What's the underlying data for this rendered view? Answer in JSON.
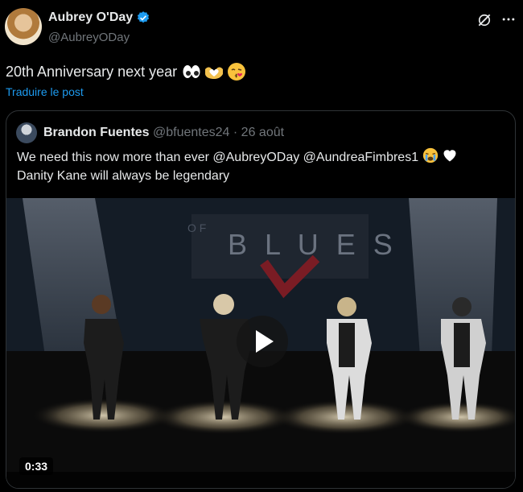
{
  "author": {
    "name": "Aubrey O'Day",
    "handle": "@AubreyODay",
    "verified": true
  },
  "post": {
    "text": "20th Anniversary next year",
    "emojis": [
      "eyes-icon",
      "hand-heart-icon",
      "kissing-face-icon"
    ]
  },
  "translate_label": "Traduire le post",
  "quote": {
    "name": "Brandon Fuentes",
    "handle": "@bfuentes24",
    "separator": "·",
    "date": "26 août",
    "text_line1": "We need this now more than ever @AubreyODay @AundreaFimbres1",
    "text_line2": "Danity Kane will always be legendary",
    "line1_emojis": [
      "crying-face-icon",
      "white-heart-icon"
    ],
    "video": {
      "duration": "0:33",
      "sign_letters": "OF BLUES"
    }
  },
  "colors": {
    "background": "#000000",
    "text": "#e7e9ea",
    "muted": "#71767b",
    "link": "#1d9bf0",
    "border": "#2f3336",
    "verified": "#1d9bf0"
  }
}
